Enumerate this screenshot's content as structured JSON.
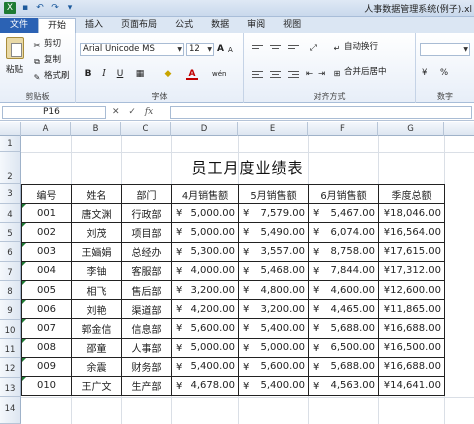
{
  "window": {
    "title": "人事数据管理系统(例子).xl"
  },
  "tabs": [
    "文件",
    "开始",
    "插入",
    "页面布局",
    "公式",
    "数据",
    "审阅",
    "视图"
  ],
  "ribbon": {
    "clipboard": {
      "label": "剪贴板",
      "paste": "粘贴",
      "cut": "剪切",
      "copy": "复制",
      "format_painter": "格式刷"
    },
    "font": {
      "label": "字体",
      "name": "Arial Unicode MS",
      "size": "12",
      "bold": "B",
      "italic": "I",
      "underline": "U",
      "font_color": "A",
      "grow": "A",
      "shrink": "A",
      "phonetic": "wén"
    },
    "alignment": {
      "label": "对齐方式",
      "wrap": "自动换行",
      "merge": "合并后居中"
    },
    "number": {
      "label": "数字",
      "currency": "¥",
      "percent": "%"
    }
  },
  "formula_bar": {
    "name_box": "P16",
    "fx": "fx",
    "formula": ""
  },
  "columns": [
    "A",
    "B",
    "C",
    "D",
    "E",
    "F",
    "G"
  ],
  "rows": [
    "1",
    "2",
    "3",
    "4",
    "5",
    "6",
    "7",
    "8",
    "9",
    "10",
    "11",
    "12",
    "13",
    "14"
  ],
  "sheet": {
    "title": "员工月度业绩表",
    "headers": [
      "编号",
      "姓名",
      "部门",
      "4月销售额",
      "5月销售额",
      "6月销售额",
      "季度总额"
    ],
    "currency_symbol": "¥",
    "records": [
      {
        "id": "001",
        "name": "唐文渊",
        "dept": "行政部",
        "apr": "5,000.00",
        "may": "7,579.00",
        "jun": "5,467.00",
        "total": "¥18,046.00"
      },
      {
        "id": "002",
        "name": "刘茂",
        "dept": "项目部",
        "apr": "5,000.00",
        "may": "5,490.00",
        "jun": "6,074.00",
        "total": "¥16,564.00"
      },
      {
        "id": "003",
        "name": "王婳娟",
        "dept": "总经办",
        "apr": "5,300.00",
        "may": "3,557.00",
        "jun": "8,758.00",
        "total": "¥17,615.00"
      },
      {
        "id": "004",
        "name": "李铀",
        "dept": "客服部",
        "apr": "4,000.00",
        "may": "5,468.00",
        "jun": "7,844.00",
        "total": "¥17,312.00"
      },
      {
        "id": "005",
        "name": "相飞",
        "dept": "售后部",
        "apr": "3,200.00",
        "may": "4,800.00",
        "jun": "4,600.00",
        "total": "¥12,600.00"
      },
      {
        "id": "006",
        "name": "刘艳",
        "dept": "渠道部",
        "apr": "4,200.00",
        "may": "3,200.00",
        "jun": "4,465.00",
        "total": "¥11,865.00"
      },
      {
        "id": "007",
        "name": "郭金信",
        "dept": "信息部",
        "apr": "5,600.00",
        "may": "5,400.00",
        "jun": "5,688.00",
        "total": "¥16,688.00"
      },
      {
        "id": "008",
        "name": "邵童",
        "dept": "人事部",
        "apr": "5,000.00",
        "may": "5,000.00",
        "jun": "6,500.00",
        "total": "¥16,500.00"
      },
      {
        "id": "009",
        "name": "余震",
        "dept": "财务部",
        "apr": "5,400.00",
        "may": "5,600.00",
        "jun": "5,688.00",
        "total": "¥16,688.00"
      },
      {
        "id": "010",
        "name": "王广文",
        "dept": "生产部",
        "apr": "4,678.00",
        "may": "5,400.00",
        "jun": "4,563.00",
        "total": "¥14,641.00"
      }
    ]
  }
}
